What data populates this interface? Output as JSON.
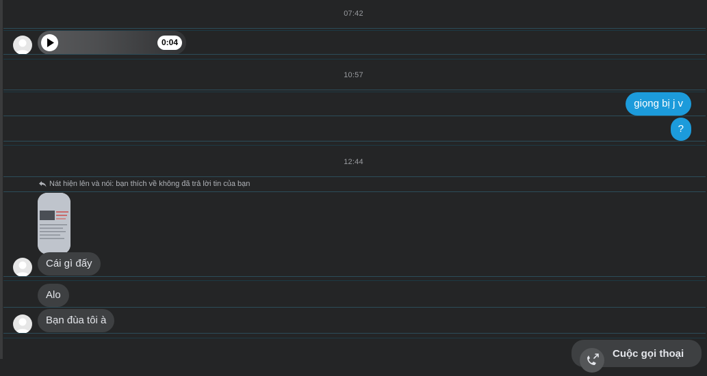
{
  "conversation": {
    "sections": [
      {
        "timestamp": "07:42"
      },
      {
        "timestamp": "10:57"
      },
      {
        "timestamp": "12:44"
      }
    ],
    "audio_message": {
      "duration": "0:04",
      "play_icon": "play-icon"
    },
    "outgoing": [
      {
        "text": "giọng bị j v"
      },
      {
        "text": "?"
      }
    ],
    "reply_note": "Nát hiện lên và nói: bạn thích về không đã trả lời tin của bạn",
    "incoming": [
      {
        "text": "Cái gì đấy"
      },
      {
        "text": "Alo"
      },
      {
        "text": "Bạn đùa tôi à"
      }
    ],
    "call": {
      "title": "Cuộc gọi thoại",
      "icon": "phone-outgoing-icon"
    }
  },
  "colors": {
    "background": "#242526",
    "incoming_bubble": "#3e4042",
    "outgoing_bubble": "#1c9bdb",
    "separator": "#2c4d5a"
  }
}
